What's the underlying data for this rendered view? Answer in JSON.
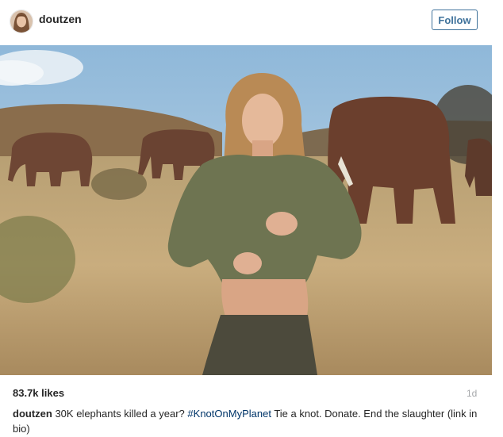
{
  "post": {
    "username": "doutzen",
    "follow_label": "Follow",
    "likes": "83.7k likes",
    "timestamp": "1d",
    "caption": {
      "username": "doutzen",
      "text_before": "30K elephants killed a year?",
      "hashtag": "#KnotOnMyPlanet",
      "text_after": "Tie a knot. Donate. End the slaughter (link in bio)"
    }
  },
  "colors": {
    "follow_accent": "#3f729b",
    "hashtag": "#003569",
    "timestamp": "#a5a7aa"
  },
  "icons": [
    "avatar"
  ]
}
